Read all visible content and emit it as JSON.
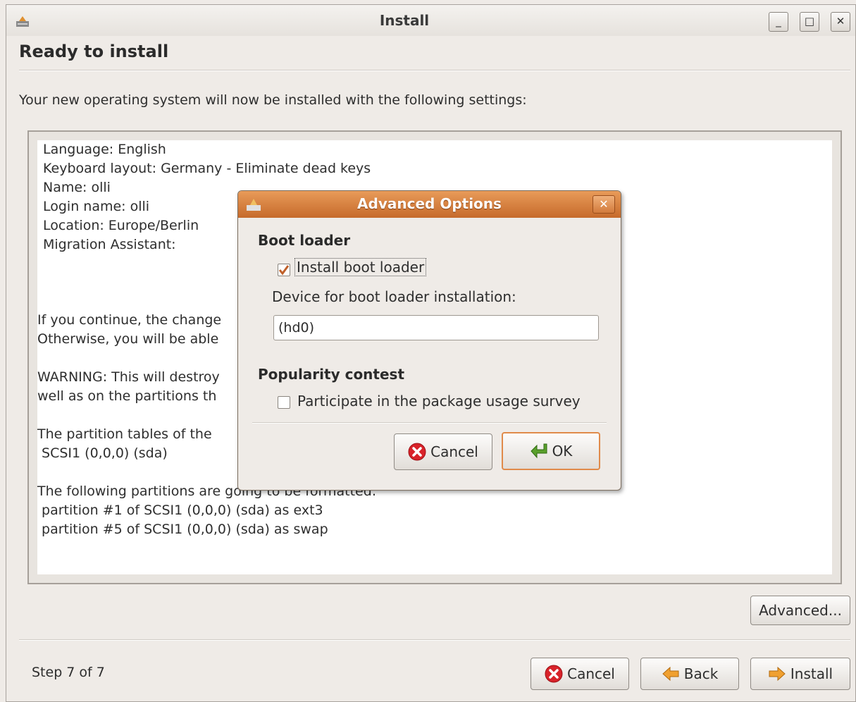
{
  "window": {
    "title": "Install",
    "minimize": "_",
    "maximize": "□",
    "close": "✕"
  },
  "page": {
    "heading": "Ready to install",
    "intro": "Your new operating system will now be installed with the following settings:"
  },
  "summary_lines": [
    "Language: English",
    "Keyboard layout: Germany - Eliminate dead keys",
    "Name: olli",
    "Login name: olli",
    "Location: Europe/Berlin",
    "Migration Assistant:",
    "If you continue, the change",
    "Otherwise, you will be able",
    "WARNING: This will destroy",
    "well as on the partitions th",
    "The partition tables of the",
    " SCSI1 (0,0,0) (sda)",
    "The following partitions are going to be formatted:",
    " partition #1 of SCSI1 (0,0,0) (sda) as ext3",
    " partition #5 of SCSI1 (0,0,0) (sda) as swap"
  ],
  "buttons": {
    "advanced": "Advanced...",
    "cancel": "Cancel",
    "back": "Back",
    "install": "Install"
  },
  "status": {
    "step": "Step 7 of 7"
  },
  "dialog": {
    "title": "Advanced Options",
    "close": "✕",
    "boot_loader_heading": "Boot loader",
    "install_boot_loader_label": "Install boot loader",
    "install_boot_loader_checked": true,
    "device_label": "Device for boot loader installation:",
    "device_value": "(hd0)",
    "popularity_heading": "Popularity contest",
    "survey_label": "Participate in the package usage survey",
    "survey_checked": false,
    "cancel": "Cancel",
    "ok": "OK"
  },
  "icons": {
    "app": "installer-icon",
    "cancel": "cancel-icon",
    "ok": "ok-arrow-icon",
    "back": "back-arrow-icon",
    "install": "forward-arrow-icon"
  },
  "colors": {
    "dialog_title_bar": "#d4783a",
    "ok_border": "#e08a4a",
    "cancel_red": "#d8232a",
    "ok_green": "#5aa02c",
    "arrow_orange": "#f0a030"
  }
}
